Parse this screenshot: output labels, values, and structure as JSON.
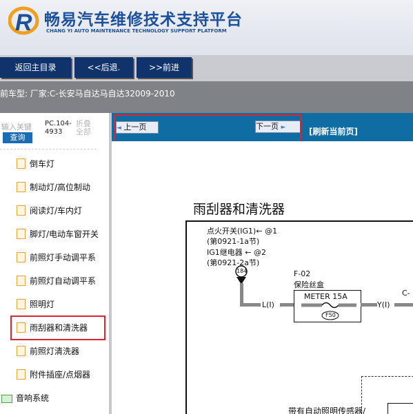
{
  "header": {
    "title_cn": "畅易汽车维修技术支持平台",
    "title_en": "CHANG YI AUTO MAINTENANCE TECHNOLOGY SUPPORT PLATFORM"
  },
  "nav": {
    "home": "返回主目录",
    "back": "<<后退.",
    "forward": ">>前进"
  },
  "breadcrumb": {
    "text": "前车型:  厂家:C-长安马自达马自达32009-2010"
  },
  "sidebar": {
    "search_placeholder": "输入关键",
    "query_label": "查询",
    "pc_code_line1": "PC.104-",
    "pc_code_line2": "4933",
    "fold_line1": "折叠",
    "fold_line2": "全部",
    "items": [
      {
        "label": "倒车灯"
      },
      {
        "label": "制动灯/高位制动"
      },
      {
        "label": "阅读灯/车内灯"
      },
      {
        "label": "脚灯/电动车窗开关"
      },
      {
        "label": "前照灯手动调平系"
      },
      {
        "label": "前照灯自动调平系"
      },
      {
        "label": "照明灯"
      },
      {
        "label": "雨刮器和清洗器"
      },
      {
        "label": "前照灯清洗器"
      },
      {
        "label": "附件插座/点烟器"
      }
    ],
    "folder": {
      "label": "音响系统"
    }
  },
  "toolbar": {
    "prev": "上一页",
    "next": "下一页",
    "refresh": "[刷新当前页]"
  },
  "diagram": {
    "title": "雨刮器和清洗器",
    "line1": "点火开关(IG1)← @1",
    "line1b": "(第0921-1a节)",
    "line2": "IG1继电器 ← @2",
    "line2b": "(第0921-2a节)",
    "connector": "184",
    "fuse_id": "F-02",
    "fuse_box": "保险丝盒",
    "fuse_name": "METER 15A",
    "fuse_code": "F50",
    "wire_left": "L(I)",
    "wire_right": "Y(I)",
    "right_edge": "C-",
    "bottom_text": "带有自动照明传感器/"
  },
  "colors": {
    "brand_blue": "#1c4f9c",
    "nav_button": "#11336b",
    "toolbar": "#0f6da4",
    "highlight_red": "#d9252f"
  }
}
